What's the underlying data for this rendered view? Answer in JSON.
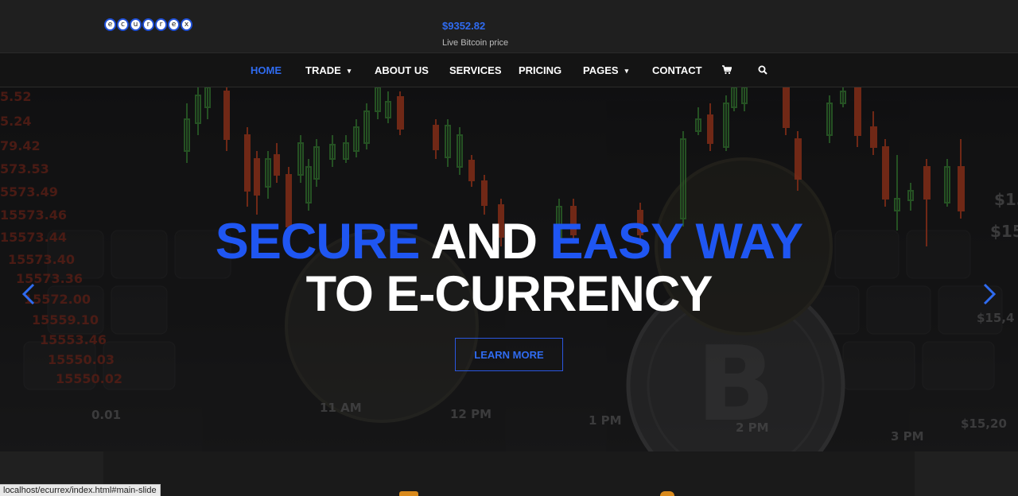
{
  "header": {
    "logo_letters": [
      "e",
      "c",
      "u",
      "r",
      "r",
      "e",
      "x"
    ],
    "price": "$9352.82",
    "price_label": "Live Bitcoin price"
  },
  "nav": {
    "items": [
      {
        "label": "HOME",
        "active": true,
        "dropdown": false
      },
      {
        "label": "TRADE",
        "active": false,
        "dropdown": true
      },
      {
        "label": "ABOUT US",
        "active": false,
        "dropdown": false
      },
      {
        "label": "SERVICES",
        "active": false,
        "dropdown": false
      },
      {
        "label": "PRICING",
        "active": false,
        "dropdown": false
      },
      {
        "label": "PAGES",
        "active": false,
        "dropdown": true
      },
      {
        "label": "CONTACT",
        "active": false,
        "dropdown": false
      }
    ],
    "cart_icon": "cart-icon",
    "search_icon": "search-icon",
    "dropdown_caret": "⌄"
  },
  "hero": {
    "headline_part1": "SECURE",
    "headline_part2": " AND ",
    "headline_part3": "EASY WAY",
    "headline_line2": "TO E-CURRENCY",
    "button_label": "LEARN MORE",
    "prev_icon": "chevron-left-icon",
    "next_icon": "chevron-right-icon",
    "accent_color": "#1f56f2"
  },
  "status_bar": {
    "url": "localhost/ecurrex/index.html#main-slide"
  }
}
